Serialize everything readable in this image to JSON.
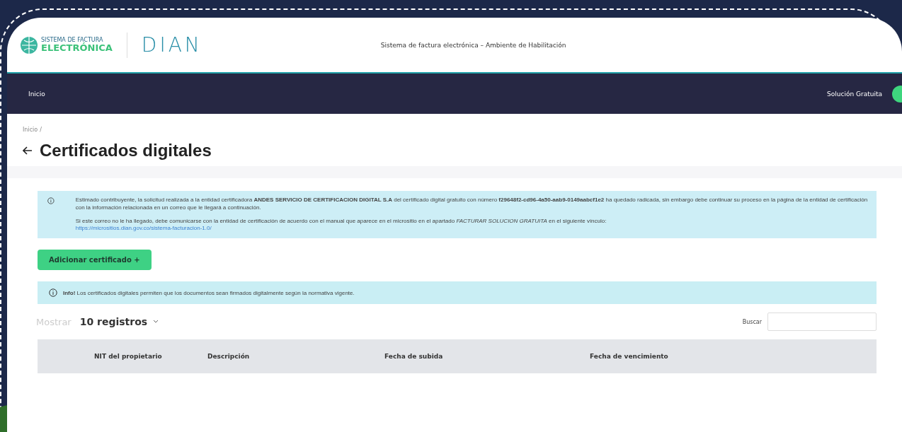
{
  "header": {
    "logo_line_1": "SISTEMA DE FACTURA",
    "logo_line_2": "ELECTRÓNICA",
    "agency": "DIAN",
    "title": "Sistema de factura electrónica – Ambiente de Habilitación"
  },
  "nav": {
    "items": [
      {
        "label": "Inicio"
      }
    ],
    "user_label": "Solución Gratuita"
  },
  "breadcrumb": [
    "Inicio",
    "/"
  ],
  "page_title": "Certificados digitales",
  "alert": {
    "paragraphs": [
      "Estimado contribuyente, la solicitud realizada a la entidad certificadora **ANDES SERVICIO DE CERTIFICACION DIGITAL S.A** del certificado digital gratuito con número **f29648f2-cd96-4a50-aab9-0149aabcf1e2** ha quedado radicada, sin embargo debe continuar su proceso en la página de la entidad de certificación con la información relacionada en un correo que le llegará a continuación.",
      "Si este correo no le ha llegado, debe comunicarse con la entidad de certificación de acuerdo con el manual que aparece en el micrositio en el apartado *FACTURAR SOLUCION GRATUITA* en el siguiente vínculo:"
    ],
    "link": "https://micrositios.dian.gov.co/sistema-facturacion-1.0/"
  },
  "add_button": "Adicionar certificado",
  "add_icon": "+",
  "info": "**Info!** Los certificados digitales permiten que los documentos sean firmados digitalmente según la normativa vigente.",
  "length": {
    "label": "Mostrar",
    "value": "10 registros"
  },
  "search": {
    "label": "Buscar"
  },
  "table": {
    "columns": [
      "NIT del propietario",
      "Descripción",
      "Fecha de subida",
      "Fecha de vencimiento"
    ]
  }
}
